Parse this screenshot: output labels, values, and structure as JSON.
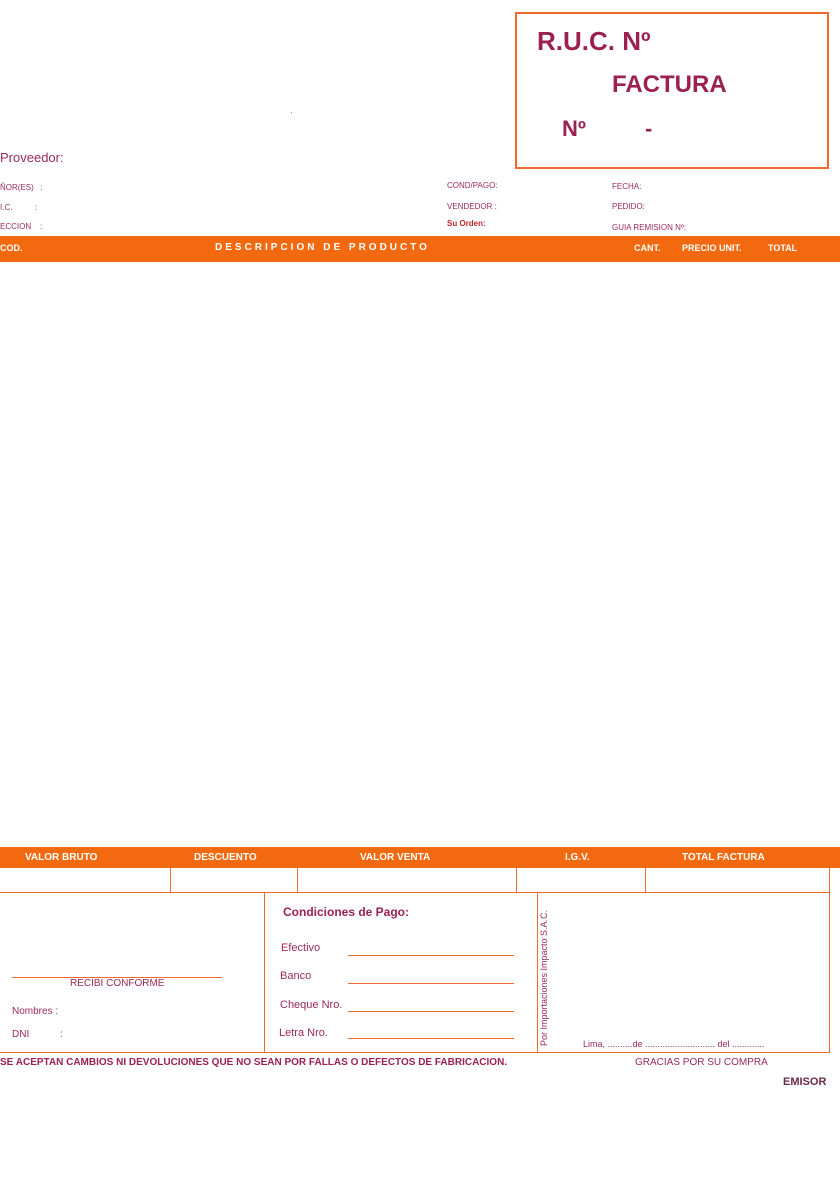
{
  "ruc_box": {
    "ruc_label": "R.U.C. Nº",
    "title": "FACTURA",
    "number_label": "Nº",
    "number_dash": "-"
  },
  "proveedor": "Proveedor:",
  "customer_fields": {
    "senores": "ÑOR(ES)   :",
    "ruc": "I.C.          :",
    "direccion": "ECCION    :"
  },
  "order_fields": {
    "cond_pago": "COND/PAGO:",
    "vendedor": "VENDEDOR :",
    "su_orden": "Su Orden:"
  },
  "date_fields": {
    "fecha": "FECHA:",
    "pedido": "PEDIDO:",
    "guia": "GUIA REMISION Nº:"
  },
  "items_header": {
    "cod": "COD.",
    "descripcion": "DESCRIPCION DE PRODUCTO",
    "cant": "CANT.",
    "precio": "PRECIO UNIT.",
    "total": "TOTAL"
  },
  "totals_header": {
    "valor_bruto": "VALOR BRUTO",
    "descuento": "DESCUENTO",
    "valor_venta": "VALOR VENTA",
    "igv": "I.G.V.",
    "total_factura": "TOTAL FACTURA"
  },
  "recibi": {
    "label": "RECIBI CONFORME",
    "nombres": "Nombres :",
    "dni": "DNI",
    "dni_colon": ":"
  },
  "condiciones": {
    "title": "Condiciones de Pago:",
    "efectivo": "Efectivo",
    "banco": "Banco",
    "cheque": "Cheque Nro.",
    "letra": "Letra Nro."
  },
  "vertical_company": "Por Importaciones Impacto S.A.C.",
  "lima_line": "Lima, ..........de ............................ del .............",
  "disclaimer": "SE ACEPTAN CAMBIOS NI DEVOLUCIONES QUE NO SEAN POR FALLAS O DEFECTOS DE FABRICACION.",
  "gracias": "GRACIAS POR SU COMPRA",
  "emisor": "EMISOR",
  "colors": {
    "accent_orange": "#f2690f",
    "border_orange": "#ef6a2c",
    "text_magenta": "#9b2151"
  }
}
